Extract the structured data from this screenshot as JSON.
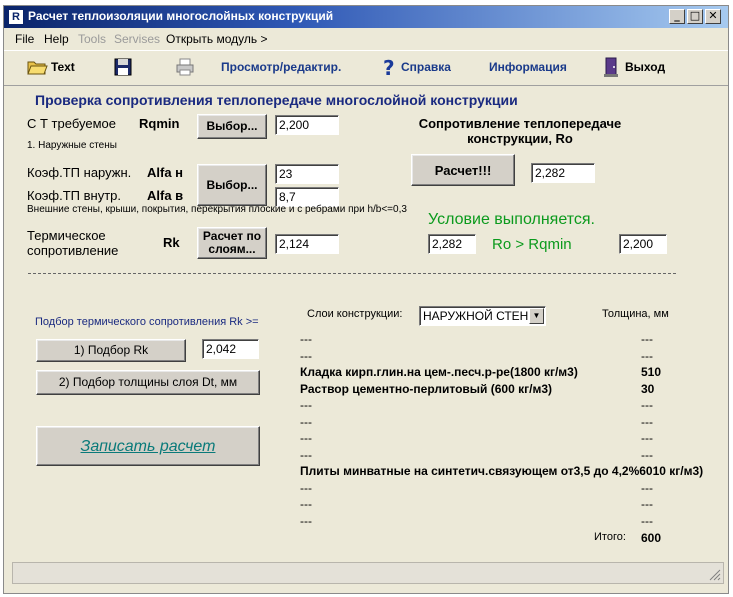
{
  "window": {
    "title": "Расчет теплоизоляции многослойных конструкций",
    "icon_letter": "R"
  },
  "menu": {
    "file": "File",
    "help": "Help",
    "tools": "Tools",
    "servises": "Servises",
    "open_module": "Открыть модуль >"
  },
  "toolbar": {
    "text": "Text",
    "view_edit": "Просмотр/редактир.",
    "help": "Справка",
    "info": "Информация",
    "exit": "Выход"
  },
  "heading": "Проверка сопротивления теплопередаче многослойной конструкции",
  "req": {
    "label": "С Т требуемое",
    "symbol": "Rqmin",
    "button": "Выбор...",
    "value": "2,200",
    "note": "1. Наружные стены"
  },
  "coef": {
    "outer_label": "Коэф.ТП наружн.",
    "outer_symbol": "Alfa н",
    "inner_label": "Коэф.ТП внутр.",
    "inner_symbol": "Alfa в",
    "button": "Выбор...",
    "outer_value": "23",
    "inner_value": "8,7",
    "note": "Внешние стены, крыши, покрытия, перекрытия плоские и с ребрами при  h/b<=0,3"
  },
  "thermal": {
    "label_line1": "Термическое",
    "label_line2": "сопротивление",
    "symbol": "Rk",
    "button_line1": "Расчет по",
    "button_line2": "слоям...",
    "value": "2,124"
  },
  "ro": {
    "title_line1": "Сопротивление теплопередаче",
    "title_line2": "конструкции, Ro",
    "calc_button": "Расчет!!!",
    "value": "2,282",
    "condition": "Условие выполняется.",
    "compare_left": "2,282",
    "compare_text": "Ro > Rqmin",
    "compare_right": "2,200"
  },
  "selection": {
    "title": "Подбор термического сопротивления Rk >=",
    "rk_button": "1)   Подбор Rk",
    "rk_value": "2,042",
    "thickness_button": "2) Подбор толщины слоя  Dt, мм",
    "save_button": "Записать расчет"
  },
  "layers": {
    "label": "Слои конструкции:",
    "selected": "НАРУЖНОЙ СТЕНЫ",
    "thickness_header": "Толщина, мм",
    "rows": [
      {
        "name": "---",
        "thickness": "---"
      },
      {
        "name": "---",
        "thickness": "---"
      },
      {
        "name": "Кладка кирп.глин.на цем-.песч.р-ре(1800 кг/м3)",
        "thickness": "510",
        "bold": true
      },
      {
        "name": "Раствор цементно-перлитовый (600 кг/м3)",
        "thickness": "30",
        "bold": true
      },
      {
        "name": "---",
        "thickness": "---"
      },
      {
        "name": "---",
        "thickness": "---"
      },
      {
        "name": "---",
        "thickness": "---"
      },
      {
        "name": "---",
        "thickness": "---"
      },
      {
        "name": "Плиты минватные на синтетич.связующем от3,5 до 4,2%6010 кг/м3)",
        "thickness": "",
        "bold": true
      },
      {
        "name": "---",
        "thickness": "---"
      },
      {
        "name": "---",
        "thickness": "---"
      },
      {
        "name": "---",
        "thickness": "---"
      }
    ],
    "total_label": "Итого:",
    "total_value": "600"
  }
}
